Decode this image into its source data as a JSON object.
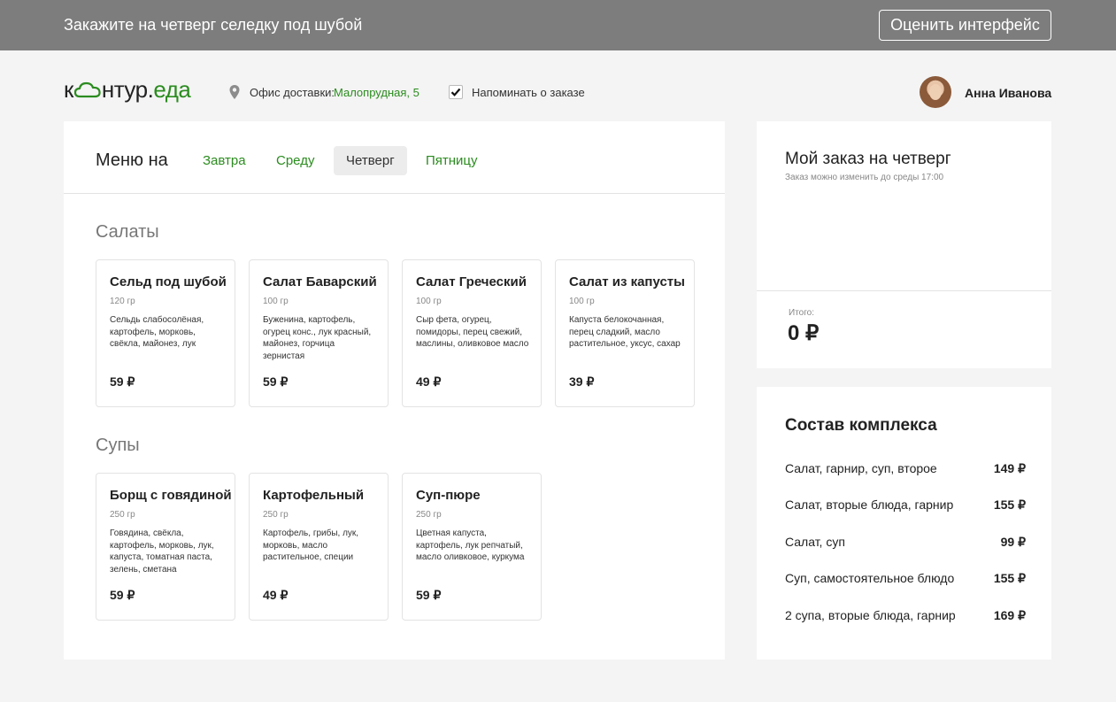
{
  "topbar": {
    "promo": "Закажите на четверг селедку под шубой",
    "rate_button": "Оценить интерфейс"
  },
  "header": {
    "logo_left": "к",
    "logo_mid": "нтур.",
    "logo_right": "еда",
    "office_label": "Офис доставки:",
    "office_value": "Малопрудная, 5",
    "remind_label": "Напоминать о заказе",
    "remind_checked": true,
    "user_name": "Анна Иванова"
  },
  "menu": {
    "title": "Меню на",
    "tabs": [
      {
        "label": "Завтра",
        "active": false
      },
      {
        "label": "Среду",
        "active": false
      },
      {
        "label": "Четверг",
        "active": true
      },
      {
        "label": "Пятницу",
        "active": false
      }
    ],
    "salads": {
      "title": "Салаты",
      "items": [
        {
          "name": "Сельд под шубой",
          "weight": "120 гр",
          "desc": "Сельдь слабосолёная, картофель, морковь, свёкла, майонез, лук",
          "price": "59 ₽"
        },
        {
          "name": "Салат Баварский",
          "weight": "100 гр",
          "desc": "Буженина, картофель, огурец конс., лук красный, майонез, горчица зернистая",
          "price": "59 ₽"
        },
        {
          "name": "Салат Греческий",
          "weight": "100 гр",
          "desc": "Сыр фета, огурец, помидоры, перец свежий, маслины, оливковое масло",
          "price": "49 ₽"
        },
        {
          "name": "Салат из капусты",
          "weight": "100 гр",
          "desc": "Капуста белокочанная, перец сладкий, масло растительное, уксус, сахар",
          "price": "39 ₽"
        }
      ]
    },
    "soups": {
      "title": "Супы",
      "items": [
        {
          "name": "Борщ с говядиной",
          "weight": "250 гр",
          "desc": "Говядина, свёкла, картофель, морковь, лук, капуста, томатная паста, зелень, сметана",
          "price": "59 ₽"
        },
        {
          "name": "Картофельный",
          "weight": "250 гр",
          "desc": "Картофель, грибы, лук, морковь, масло растительное, специи",
          "price": "49 ₽"
        },
        {
          "name": "Суп-пюре",
          "weight": "250 гр",
          "desc": "Цветная капуста, картофель, лук репчатый, масло оливковое, куркума",
          "price": "59 ₽"
        }
      ]
    }
  },
  "order": {
    "title": "Мой заказ на четверг",
    "subtitle": "Заказ можно изменить до среды 17:00",
    "total_label": "Итого:",
    "total_value": "0 ₽"
  },
  "combo": {
    "title": "Состав комплекса",
    "rows": [
      {
        "label": "Салат, гарнир, суп, второе",
        "price": "149 ₽"
      },
      {
        "label": "Салат, вторые блюда, гарнир",
        "price": "155 ₽"
      },
      {
        "label": "Салат, суп",
        "price": "99 ₽"
      },
      {
        "label": "Суп, самостоятельное блюдо",
        "price": "155 ₽"
      },
      {
        "label": "2 супа, вторые блюда, гарнир",
        "price": "169 ₽"
      }
    ]
  },
  "colors": {
    "topbar": "#7d7d7d",
    "brand_green": "#2b8c1f",
    "background": "#f4f4f4"
  },
  "icons": [
    "location-pin-icon",
    "checkmark-icon",
    "cloud-logo-icon"
  ]
}
